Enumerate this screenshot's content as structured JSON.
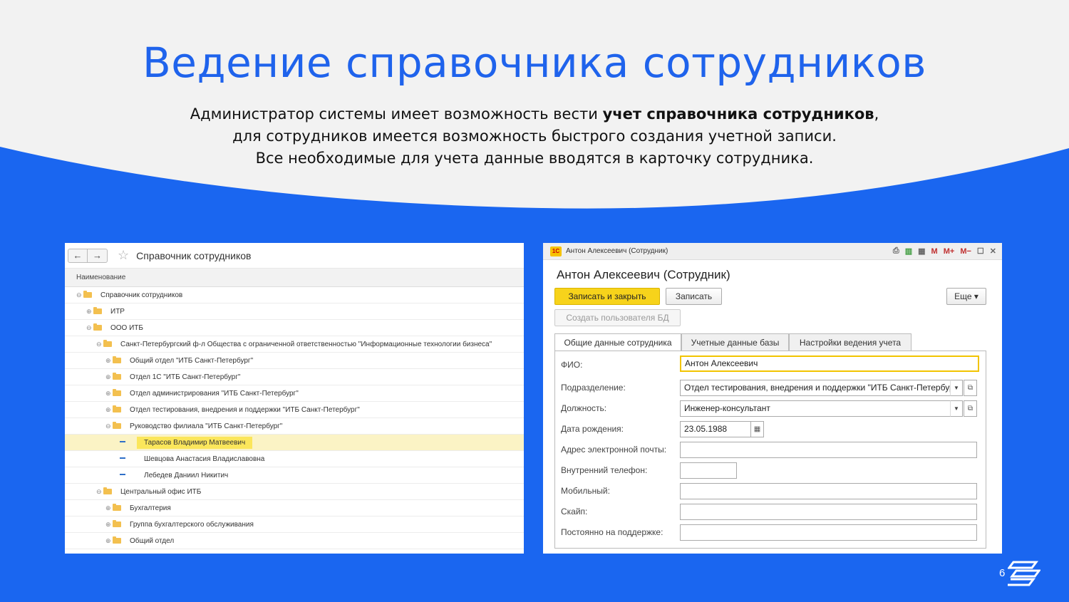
{
  "slide": {
    "title": "Ведение справочника сотрудников",
    "subtitle_line1_pre": "Администратор системы имеет возможность вести ",
    "subtitle_line1_bold": "учет справочника сотрудников",
    "subtitle_line1_post": ",",
    "subtitle_line2": "для сотрудников имеется возможность быстрого создания учетной записи.",
    "subtitle_line3": "Все необходимые для учета данные вводятся в карточку сотрудника.",
    "page_number": "6"
  },
  "list": {
    "back": "←",
    "forward": "→",
    "star": "☆",
    "title": "Справочник сотрудников",
    "column": "Наименование",
    "rows": [
      {
        "label": "Справочник сотрудников",
        "type": "folder",
        "exp": "⊖"
      },
      {
        "label": "ИТР",
        "type": "folder",
        "exp": "⊕"
      },
      {
        "label": "ООО ИТБ",
        "type": "folder",
        "exp": "⊖"
      },
      {
        "label": "Санкт-Петербургский ф-л Общества с ограниченной ответственностью \"Информационные технологии бизнеса\"",
        "type": "folder",
        "exp": "⊖"
      },
      {
        "label": "Общий отдел  \"ИТБ Санкт-Петербург\"",
        "type": "folder",
        "exp": "⊕"
      },
      {
        "label": "Отдел 1С \"ИТБ Санкт-Петербург\"",
        "type": "folder",
        "exp": "⊕"
      },
      {
        "label": "Отдел администрирования  \"ИТБ Санкт-Петербург\"",
        "type": "folder",
        "exp": "⊕"
      },
      {
        "label": "Отдел тестирования, внедрения и поддержки \"ИТБ Санкт-Петербург\"",
        "type": "folder",
        "exp": "⊕"
      },
      {
        "label": "Руководство филиала \"ИТБ Санкт-Петербург\"",
        "type": "folder",
        "exp": "⊖"
      },
      {
        "label": "Тарасов Владимир Матвеевич",
        "type": "item",
        "exp": "",
        "selected": true
      },
      {
        "label": "Шевцова Анастасия Владиславовна",
        "type": "item",
        "exp": ""
      },
      {
        "label": "Лебедев Даниил Никитич",
        "type": "item",
        "exp": ""
      },
      {
        "label": "Центральный офис ИТБ",
        "type": "folder",
        "exp": "⊖"
      },
      {
        "label": "Бухгалтерия",
        "type": "folder",
        "exp": "⊕"
      },
      {
        "label": "Группа бухгалтерского обслуживания",
        "type": "folder",
        "exp": "⊕"
      },
      {
        "label": "Общий отдел",
        "type": "folder",
        "exp": "⊕"
      }
    ]
  },
  "form": {
    "app_logo": "1С",
    "window_title": "Антон Алексеевич (Сотрудник)",
    "toolbar_m": "M",
    "toolbar_mplus": "M+",
    "toolbar_mminus": "M−",
    "maximize": "☐",
    "close": "✕",
    "title": "Антон Алексеевич (Сотрудник)",
    "save_close": "Записать и закрыть",
    "save": "Записать",
    "more": "Еще ▾",
    "create_user": "Создать пользователя БД",
    "tabs": [
      "Общие данные сотрудника",
      "Учетные данные базы",
      "Настройки ведения учета"
    ],
    "fields": {
      "fio_label": "ФИО:",
      "fio_value": "Антон Алексеевич",
      "dept_label": "Подразделение:",
      "dept_value": "Отдел тестирования, внедрения и поддержки \"ИТБ Санкт-Петербург\"",
      "position_label": "Должность:",
      "position_value": "Инженер-консультант",
      "birth_label": "Дата рождения:",
      "birth_value": "23.05.1988",
      "email_label": "Адрес электронной почты:",
      "email_value": "",
      "phone_label": "Внутренний телефон:",
      "phone_value": "",
      "mobile_label": "Мобильный:",
      "mobile_value": "",
      "skype_label": "Скайп:",
      "skype_value": "",
      "support_label": "Постоянно на поддержке:",
      "support_value": ""
    }
  },
  "colors": {
    "background_blue": "#1a66f0",
    "title_blue": "#1f63ec",
    "accent_yellow": "#f7d31b",
    "top_area": "#f2f2f2"
  }
}
